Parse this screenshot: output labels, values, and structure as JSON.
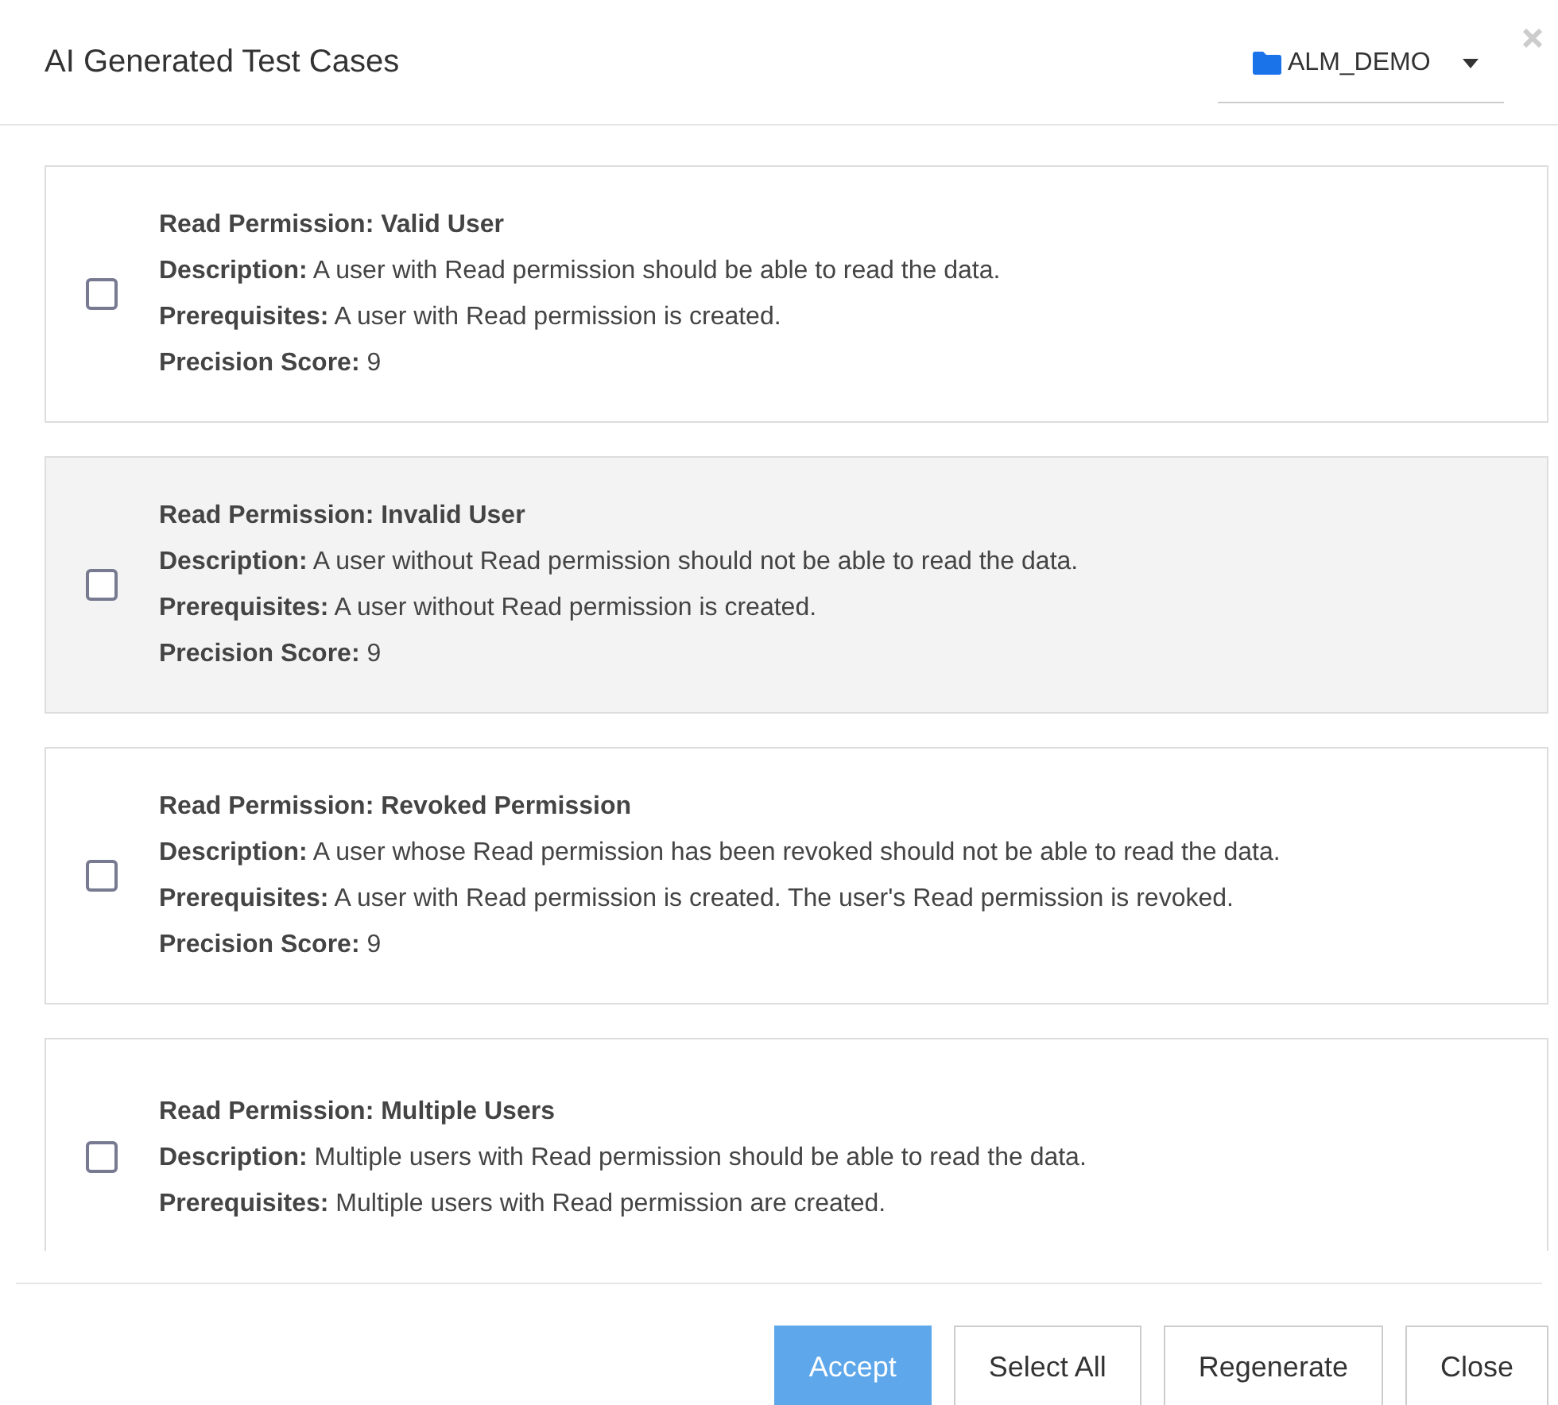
{
  "dialog": {
    "title": "AI Generated Test Cases",
    "project": "ALM_DEMO"
  },
  "test_cases": [
    {
      "title": "Read Permission: Valid User",
      "fields": [
        {
          "label": "Description:",
          "value": "A user with Read permission should be able to read the data."
        },
        {
          "label": "Prerequisites:",
          "value": "A user with Read permission is created."
        },
        {
          "label": "Precision Score:",
          "value": "9"
        }
      ],
      "checked": false,
      "highlighted": false
    },
    {
      "title": "Read Permission: Invalid User",
      "fields": [
        {
          "label": "Description:",
          "value": "A user without Read permission should not be able to read the data."
        },
        {
          "label": "Prerequisites:",
          "value": "A user without Read permission is created."
        },
        {
          "label": "Precision Score:",
          "value": "9"
        }
      ],
      "checked": false,
      "highlighted": true
    },
    {
      "title": "Read Permission: Revoked Permission",
      "fields": [
        {
          "label": "Description:",
          "value": "A user whose Read permission has been revoked should not be able to read the data."
        },
        {
          "label": "Prerequisites:",
          "value": "A user with Read permission is created. The user's Read permission is revoked."
        },
        {
          "label": "Precision Score:",
          "value": "9"
        }
      ],
      "checked": false,
      "highlighted": false
    },
    {
      "title": "Read Permission: Multiple Users",
      "fields": [
        {
          "label": "Description:",
          "value": "Multiple users with Read permission should be able to read the data."
        },
        {
          "label": "Prerequisites:",
          "value": "Multiple users with Read permission are created."
        }
      ],
      "checked": false,
      "highlighted": false
    }
  ],
  "buttons": [
    {
      "label": "Accept",
      "kind": "primary",
      "disabled": true
    },
    {
      "label": "Select All",
      "kind": "default",
      "disabled": false
    },
    {
      "label": "Regenerate",
      "kind": "default",
      "disabled": false
    },
    {
      "label": "Close",
      "kind": "default",
      "disabled": false
    }
  ]
}
